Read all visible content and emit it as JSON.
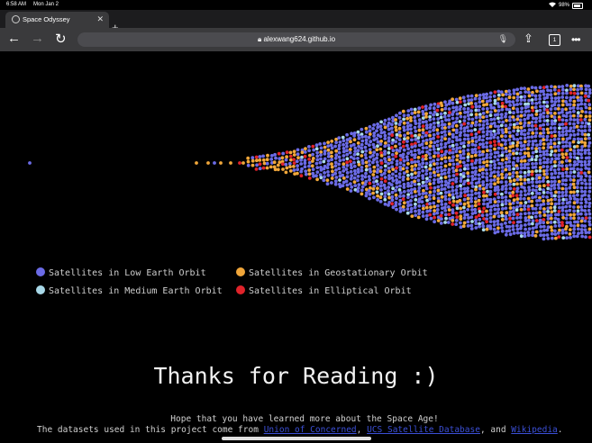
{
  "status_bar": {
    "time": "6:58 AM",
    "date": "Mon Jan 2",
    "battery": "98%"
  },
  "browser": {
    "tab_title": "Space Odyssey",
    "new_tab": "+",
    "url": "alexwang624.github.io",
    "tab_count": "1",
    "icons": [
      "globe-icon",
      "close-icon",
      "plus-icon",
      "back-icon",
      "forward-icon",
      "reload-icon",
      "lock-icon",
      "mic-icon",
      "share-icon",
      "tabs-icon",
      "more-icon",
      "wifi-icon",
      "battery-icon"
    ]
  },
  "colors": {
    "leo": "#6b6be6",
    "meo": "#a8d8e8",
    "geo": "#f0a63a",
    "elliptical": "#e0232a",
    "background": "#000000"
  },
  "legend": [
    {
      "label": "Satellites in Low Earth Orbit",
      "color": "#6b6be6"
    },
    {
      "label": "Satellites in Geostationary Orbit",
      "color": "#f0a63a"
    },
    {
      "label": "Satellites in Medium Earth Orbit",
      "color": "#a8d8e8"
    },
    {
      "label": "Satellites in Elliptical Orbit",
      "color": "#e0232a"
    }
  ],
  "content": {
    "thanks": "Thanks for Reading :)",
    "hope": "Hope that you have learned more about the Space Age!",
    "datasets_prefix": "The datasets used in this project come from",
    "link1": "Union of Concerned",
    "sep1": ",",
    "link2": "UCS Satellite Database",
    "sep2": ", and",
    "link3": "Wikipedia",
    "suffix": "."
  }
}
